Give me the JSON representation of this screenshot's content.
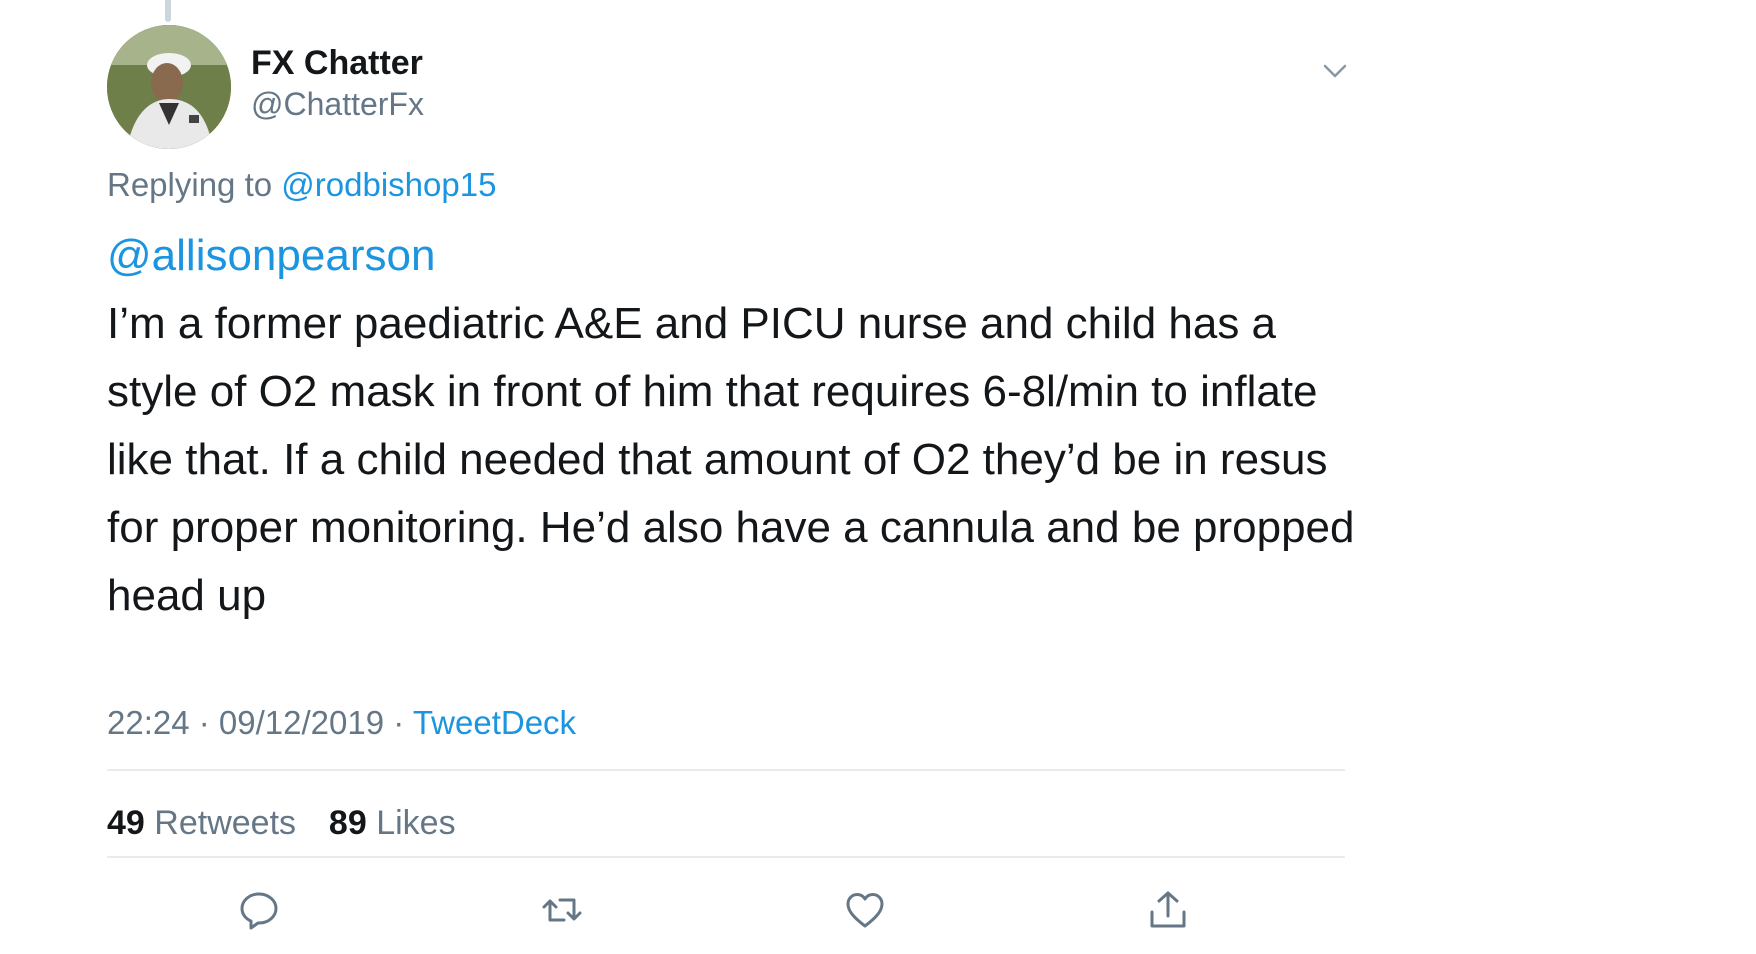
{
  "author": {
    "display_name": "FX Chatter",
    "handle": "@ChatterFx"
  },
  "reply": {
    "prefix": "Replying to",
    "to_handle": "@rodbishop15"
  },
  "tweet": {
    "mention": "@allisonpearson",
    "text": "I’m a former paediatric A&E and PICU nurse and child has a style of O2 mask in front of him that requires 6-8l/min to inflate like that. If a child needed that amount of O2 they’d be in resus for proper monitoring. He’d also have a cannula and be propped head up"
  },
  "meta": {
    "time": "22:24",
    "separator1": " · ",
    "date": "09/12/2019",
    "separator2": " · ",
    "source": "TweetDeck"
  },
  "stats": {
    "retweets_count": "49",
    "retweets_label": "Retweets",
    "likes_count": "89",
    "likes_label": "Likes"
  },
  "icons": {
    "menu": "chevron-down-icon",
    "reply": "reply-icon",
    "retweet": "retweet-icon",
    "like": "heart-icon",
    "share": "share-icon"
  },
  "colors": {
    "link": "#1b95e0",
    "secondary_text": "#657786",
    "primary_text": "#14171a",
    "divider": "#e6ecf0"
  }
}
